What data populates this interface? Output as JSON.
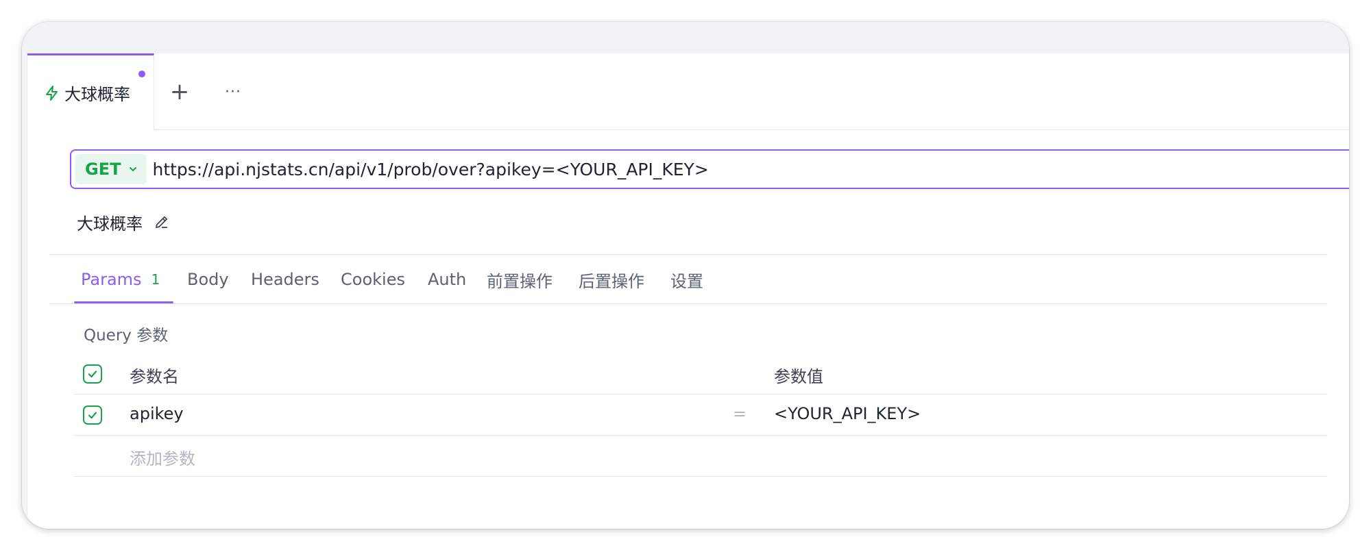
{
  "tab": {
    "title": "大球概率",
    "unsaved": true
  },
  "tabbar": {
    "add_label": "+",
    "more_label": "···"
  },
  "request": {
    "method": "GET",
    "url": "https://api.njstats.cn/api/v1/prob/over?apikey=<YOUR_API_KEY>",
    "name": "大球概率"
  },
  "param_tabs": [
    {
      "label": "Params",
      "badge": "1",
      "active": true
    },
    {
      "label": "Body"
    },
    {
      "label": "Headers"
    },
    {
      "label": "Cookies"
    },
    {
      "label": "Auth"
    },
    {
      "label": "前置操作"
    },
    {
      "label": "后置操作"
    },
    {
      "label": "设置"
    }
  ],
  "query": {
    "label": "Query 参数",
    "header": {
      "name": "参数名",
      "value": "参数值"
    },
    "rows": [
      {
        "name": "apikey",
        "separator": "=",
        "value": "<YOUR_API_KEY>",
        "enabled": true
      }
    ],
    "add_placeholder": "添加参数"
  },
  "colors": {
    "accent": "#8b5cf6",
    "method_get": "#16a34a",
    "method_bg": "#e8f6ee"
  },
  "icons": [
    "bolt-icon",
    "chevron-down-icon",
    "edit-icon",
    "check-icon"
  ]
}
